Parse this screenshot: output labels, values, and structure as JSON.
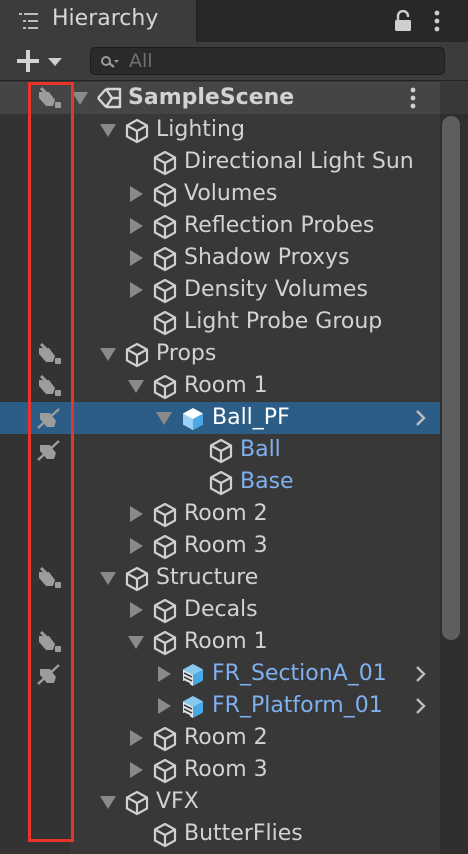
{
  "window": {
    "tab_title": "Hierarchy",
    "tab_icon": "hierarchy-list-icon",
    "lock_icon": "lock-icon",
    "menu_icon": "kebab-menu-icon"
  },
  "toolbar": {
    "add_icon": "plus-icon",
    "dropdown_icon": "triangle-down-icon",
    "search_placeholder": "All",
    "search_icon": "search-icon"
  },
  "colors": {
    "selection": "#2c5d87",
    "prefab_text": "#7fb0f0",
    "highlight_box": "#e8352b"
  },
  "rows": [
    {
      "label": "SampleScene",
      "depth": 0,
      "type": "scene",
      "expand": "down",
      "icon": "unity-scene-icon",
      "vis": "hidden",
      "menu": true
    },
    {
      "label": "Lighting",
      "depth": 1,
      "type": "object",
      "expand": "down",
      "icon": "gameobject-cube-icon",
      "vis": ""
    },
    {
      "label": "Directional Light Sun",
      "depth": 2,
      "type": "object",
      "expand": "none",
      "icon": "gameobject-cube-icon",
      "vis": ""
    },
    {
      "label": "Volumes",
      "depth": 2,
      "type": "object",
      "expand": "right",
      "icon": "gameobject-cube-icon",
      "vis": ""
    },
    {
      "label": "Reflection Probes",
      "depth": 2,
      "type": "object",
      "expand": "right",
      "icon": "gameobject-cube-icon",
      "vis": ""
    },
    {
      "label": "Shadow Proxys",
      "depth": 2,
      "type": "object",
      "expand": "right",
      "icon": "gameobject-cube-icon",
      "vis": ""
    },
    {
      "label": "Density Volumes",
      "depth": 2,
      "type": "object",
      "expand": "right",
      "icon": "gameobject-cube-icon",
      "vis": ""
    },
    {
      "label": "Light Probe Group",
      "depth": 2,
      "type": "object",
      "expand": "none",
      "icon": "gameobject-cube-icon",
      "vis": ""
    },
    {
      "label": "Props",
      "depth": 1,
      "type": "object",
      "expand": "down",
      "icon": "gameobject-cube-icon",
      "vis": "hidden"
    },
    {
      "label": "Room 1",
      "depth": 2,
      "type": "object",
      "expand": "down",
      "icon": "gameobject-cube-icon",
      "vis": "hidden"
    },
    {
      "label": "Ball_PF",
      "depth": 3,
      "type": "prefab-root",
      "expand": "down",
      "icon": "prefab-cube-icon",
      "vis": "off",
      "selected": true,
      "chevron": true
    },
    {
      "label": "Ball",
      "depth": 4,
      "type": "prefab-child",
      "expand": "none",
      "icon": "gameobject-cube-icon",
      "vis": "off"
    },
    {
      "label": "Base",
      "depth": 4,
      "type": "prefab-child",
      "expand": "none",
      "icon": "gameobject-cube-icon",
      "vis": ""
    },
    {
      "label": "Room 2",
      "depth": 2,
      "type": "object",
      "expand": "right",
      "icon": "gameobject-cube-icon",
      "vis": ""
    },
    {
      "label": "Room 3",
      "depth": 2,
      "type": "object",
      "expand": "right",
      "icon": "gameobject-cube-icon",
      "vis": ""
    },
    {
      "label": "Structure",
      "depth": 1,
      "type": "object",
      "expand": "down",
      "icon": "gameobject-cube-icon",
      "vis": "hidden"
    },
    {
      "label": "Decals",
      "depth": 2,
      "type": "object",
      "expand": "right",
      "icon": "gameobject-cube-icon",
      "vis": ""
    },
    {
      "label": "Room 1",
      "depth": 2,
      "type": "object",
      "expand": "down",
      "icon": "gameobject-cube-icon",
      "vis": "hidden"
    },
    {
      "label": "FR_SectionA_01",
      "depth": 3,
      "type": "model-prefab",
      "expand": "right",
      "icon": "model-prefab-icon",
      "vis": "off",
      "chevron": true
    },
    {
      "label": "FR_Platform_01",
      "depth": 3,
      "type": "model-prefab",
      "expand": "right",
      "icon": "model-prefab-icon",
      "vis": "",
      "chevron": true
    },
    {
      "label": "Room 2",
      "depth": 2,
      "type": "object",
      "expand": "right",
      "icon": "gameobject-cube-icon",
      "vis": ""
    },
    {
      "label": "Room 3",
      "depth": 2,
      "type": "object",
      "expand": "right",
      "icon": "gameobject-cube-icon",
      "vis": ""
    },
    {
      "label": "VFX",
      "depth": 1,
      "type": "object",
      "expand": "down",
      "icon": "gameobject-cube-icon",
      "vis": ""
    },
    {
      "label": "ButterFlies",
      "depth": 2,
      "type": "object",
      "expand": "none",
      "icon": "gameobject-cube-icon",
      "vis": ""
    }
  ]
}
